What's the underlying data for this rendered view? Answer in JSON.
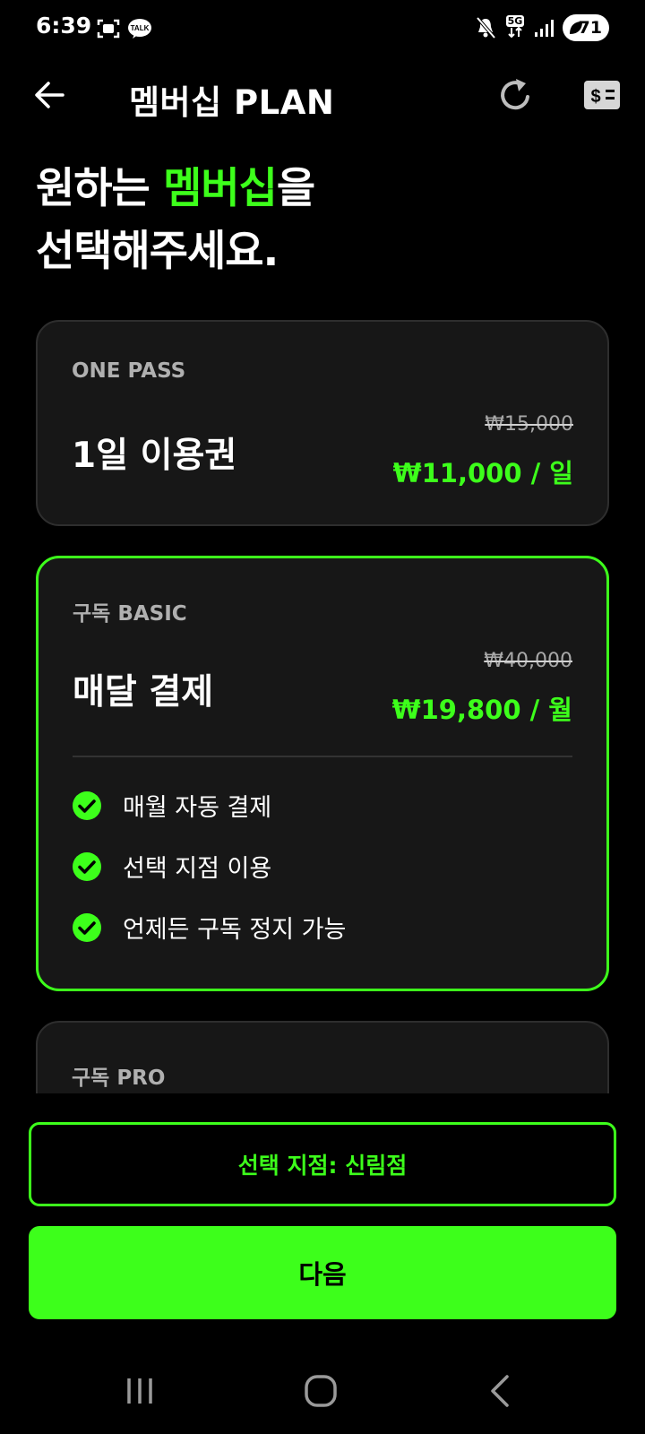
{
  "status_bar": {
    "time": "6:39",
    "left_icons": [
      "screenshot-icon",
      "kakaotalk-icon"
    ],
    "kakao_label": "TALK",
    "network_label": "5G",
    "battery": "71",
    "right_icons": [
      "mute-icon",
      "network-5g-icon",
      "signal-icon",
      "battery-icon"
    ]
  },
  "header": {
    "title": "멤버십 PLAN",
    "icons": [
      "back-arrow-icon",
      "refresh-icon",
      "coupon-icon"
    ]
  },
  "headline": {
    "line1_prefix": "원하는 ",
    "line1_accent": "멤버십",
    "line1_suffix": "을",
    "line2": "선택해주세요."
  },
  "plans": [
    {
      "kicker": "ONE PASS",
      "name": "1일 이용권",
      "old_price": "₩15,000",
      "new_price": "₩11,000 / 일",
      "selected": false
    },
    {
      "kicker": "구독 BASIC",
      "name": "매달 결제",
      "old_price": "₩40,000",
      "new_price": "₩19,800 / 월",
      "selected": true,
      "features": [
        "매월 자동 결제",
        "선택 지점 이용",
        "언제든 구독 정지 가능"
      ]
    },
    {
      "kicker": "구독 PRO",
      "selected": false
    }
  ],
  "branch_button": {
    "label": "선택 지점: 신림점"
  },
  "next_button": {
    "label": "다음"
  },
  "colors": {
    "accent": "#3dff1b",
    "background": "#000000",
    "card": "#171717",
    "card_border": "#2e2e2e"
  },
  "nav_bar": {
    "icons": [
      "recents-icon",
      "home-icon",
      "back-icon"
    ]
  }
}
